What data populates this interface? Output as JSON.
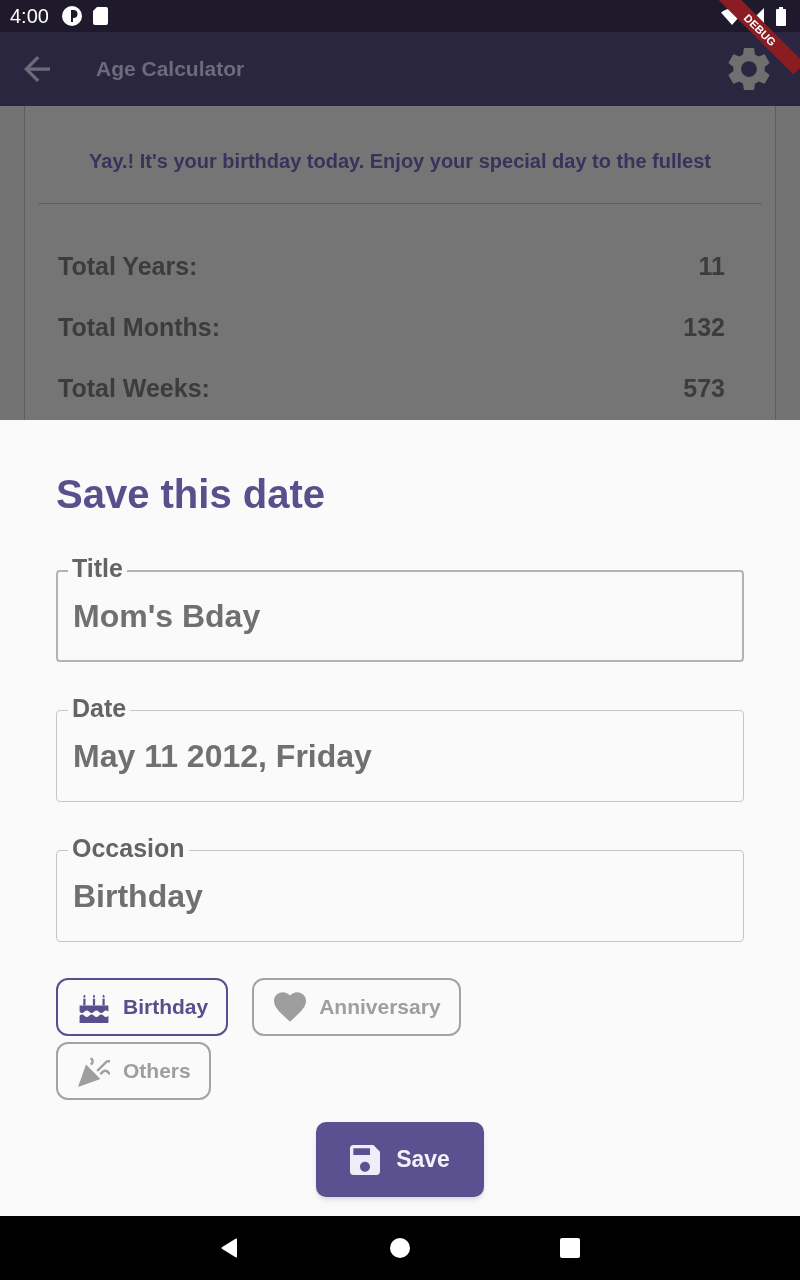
{
  "status_bar": {
    "time": "4:00"
  },
  "debug_banner": {
    "label": "DEBUG"
  },
  "app_bar": {
    "title": "Age Calculator"
  },
  "result_card": {
    "message": "Yay.! It's your birthday today. Enjoy your special day to the fullest",
    "stats": [
      {
        "label": "Total Years:",
        "value": "11"
      },
      {
        "label": "Total Months:",
        "value": "132"
      },
      {
        "label": "Total Weeks:",
        "value": "573"
      }
    ]
  },
  "save_sheet": {
    "title": "Save this date",
    "fields": [
      {
        "label": "Title",
        "value": "Mom's Bday",
        "focused": true
      },
      {
        "label": "Date",
        "value": "May 11 2012, Friday",
        "focused": false
      },
      {
        "label": "Occasion",
        "value": "Birthday",
        "focused": false
      }
    ],
    "occasions": [
      {
        "kind": "birthday",
        "label": "Birthday",
        "selected": true
      },
      {
        "kind": "anniversary",
        "label": "Anniversary",
        "selected": false
      },
      {
        "kind": "others",
        "label": "Others",
        "selected": false
      }
    ],
    "save_button": {
      "label": "Save"
    }
  }
}
